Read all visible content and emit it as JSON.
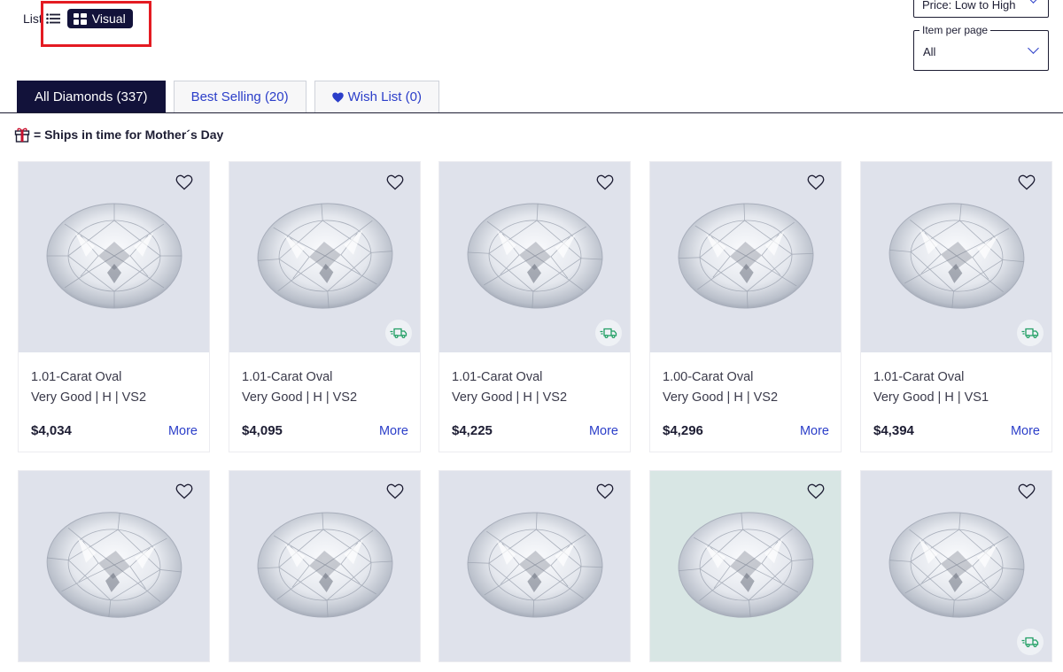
{
  "view_toggle": {
    "list_label": "List",
    "visual_label": "Visual"
  },
  "sort": {
    "value": "Price: Low to High"
  },
  "per_page": {
    "legend": "Item per page",
    "value": "All"
  },
  "tabs": [
    {
      "label": "All Diamonds (337)",
      "active": true
    },
    {
      "label": "Best Selling (20)",
      "active": false
    },
    {
      "label": "Wish List (0)",
      "active": false
    }
  ],
  "ships_note": "= Ships in time for Mother´s Day",
  "products": [
    {
      "title": "1.01-Carat Oval",
      "specs": "Very Good | H | VS2",
      "price": "$4,034",
      "more": "More",
      "ships_fast": false
    },
    {
      "title": "1.01-Carat Oval",
      "specs": "Very Good | H | VS2",
      "price": "$4,095",
      "more": "More",
      "ships_fast": true
    },
    {
      "title": "1.01-Carat Oval",
      "specs": "Very Good | H | VS2",
      "price": "$4,225",
      "more": "More",
      "ships_fast": true
    },
    {
      "title": "1.00-Carat Oval",
      "specs": "Very Good | H | VS2",
      "price": "$4,296",
      "more": "More",
      "ships_fast": false
    },
    {
      "title": "1.01-Carat Oval",
      "specs": "Very Good | H | VS1",
      "price": "$4,394",
      "more": "More",
      "ships_fast": true
    },
    {
      "title": "",
      "specs": "",
      "price": "",
      "more": "",
      "ships_fast": false
    },
    {
      "title": "",
      "specs": "",
      "price": "",
      "more": "",
      "ships_fast": false
    },
    {
      "title": "",
      "specs": "",
      "price": "",
      "more": "",
      "ships_fast": false
    },
    {
      "title": "",
      "specs": "",
      "price": "",
      "more": "",
      "ships_fast": false
    },
    {
      "title": "",
      "specs": "",
      "price": "",
      "more": "",
      "ships_fast": true
    }
  ],
  "colors": {
    "navy": "#12123a",
    "link_blue": "#2b3ec9",
    "highlight_red": "#e41b22",
    "truck_green": "#1f9e63"
  }
}
